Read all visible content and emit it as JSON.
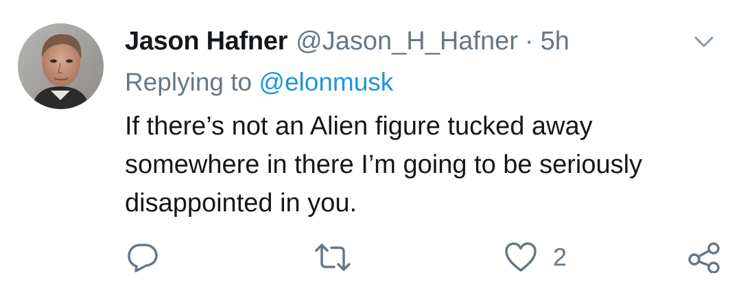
{
  "tweet": {
    "display_name": "Jason Hafner",
    "handle": "@Jason_H_Hafner",
    "separator": "·",
    "time": "5h",
    "replying_to_prefix": "Replying to ",
    "replying_to_handle": "@elonmusk",
    "text_lines": [
      "If there’s not an Alien figure tucked away",
      "somewhere in there I’m going to be seriously",
      "disappointed in you."
    ]
  },
  "actions": {
    "reply": {
      "icon": "reply-icon"
    },
    "retweet": {
      "icon": "retweet-icon"
    },
    "like": {
      "icon": "heart-icon",
      "count": "2"
    },
    "share": {
      "icon": "share-icon"
    }
  },
  "colors": {
    "text": "#14171a",
    "secondary": "#657786",
    "link": "#1b95e0"
  }
}
